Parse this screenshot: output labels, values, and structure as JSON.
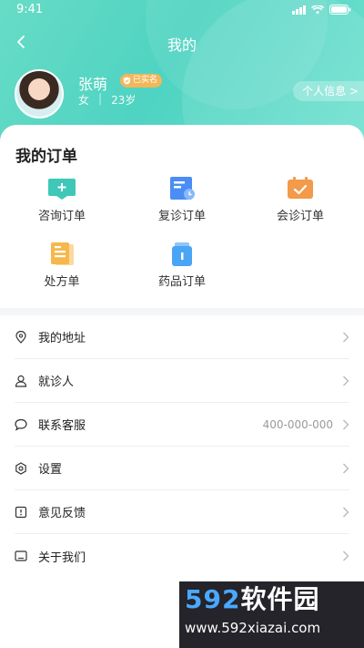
{
  "status_bar": {
    "time": "9:41"
  },
  "nav": {
    "title": "我的"
  },
  "user": {
    "name": "张萌",
    "badge": "已实名",
    "gender": "女",
    "separator": "|",
    "age": "23岁",
    "profile_link": "个人信息 >"
  },
  "orders": {
    "title": "我的订单",
    "items": [
      {
        "label": "咨询订单",
        "icon": "consult-icon",
        "color": "#3fc8b8"
      },
      {
        "label": "复诊订单",
        "icon": "revisit-icon",
        "color": "#4a8df5"
      },
      {
        "label": "会诊订单",
        "icon": "consultation-icon",
        "color": "#f39a4b"
      },
      {
        "label": "处方单",
        "icon": "prescription-icon",
        "color": "#f6b84c"
      },
      {
        "label": "药品订单",
        "icon": "medicine-icon",
        "color": "#4aa5f5"
      }
    ]
  },
  "menu": [
    {
      "label": "我的地址",
      "icon": "location-icon",
      "value": ""
    },
    {
      "label": "就诊人",
      "icon": "person-icon",
      "value": ""
    },
    {
      "label": "联系客服",
      "icon": "chat-icon",
      "value": "400-000-000"
    },
    {
      "label": "设置",
      "icon": "settings-icon",
      "value": ""
    },
    {
      "label": "意见反馈",
      "icon": "feedback-icon",
      "value": ""
    },
    {
      "label": "关于我们",
      "icon": "about-icon",
      "value": ""
    }
  ],
  "watermark": {
    "brand_num": "592",
    "brand_cn": "软件园",
    "url": "www.592xiazai.com"
  }
}
